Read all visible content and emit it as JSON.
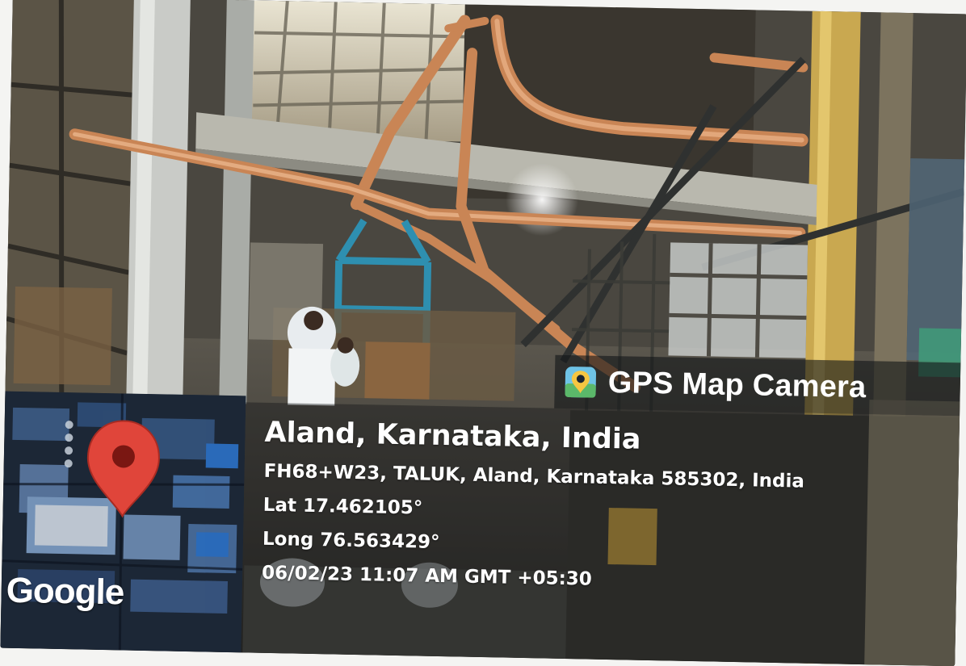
{
  "overlay": {
    "app_name": "GPS Map Camera",
    "icon": "gps-map-camera-app-icon",
    "address_title": "Aland, Karnataka, India",
    "address_full": "FH68+W23, TALUK, Aland, Karnataka 585302, India",
    "latitude": "Lat 17.462105°",
    "longitude": "Long 76.563429°",
    "timestamp": "06/02/23 11:07 AM GMT +05:30"
  },
  "map": {
    "provider_label": "Google",
    "marker_icon": "map-pin-icon",
    "marker_color": "#e0453a"
  },
  "colors": {
    "pipe": "#c98555",
    "steel_blue": "#2e8fb0",
    "beam": "#bdbcb3",
    "panel": "#141618"
  }
}
